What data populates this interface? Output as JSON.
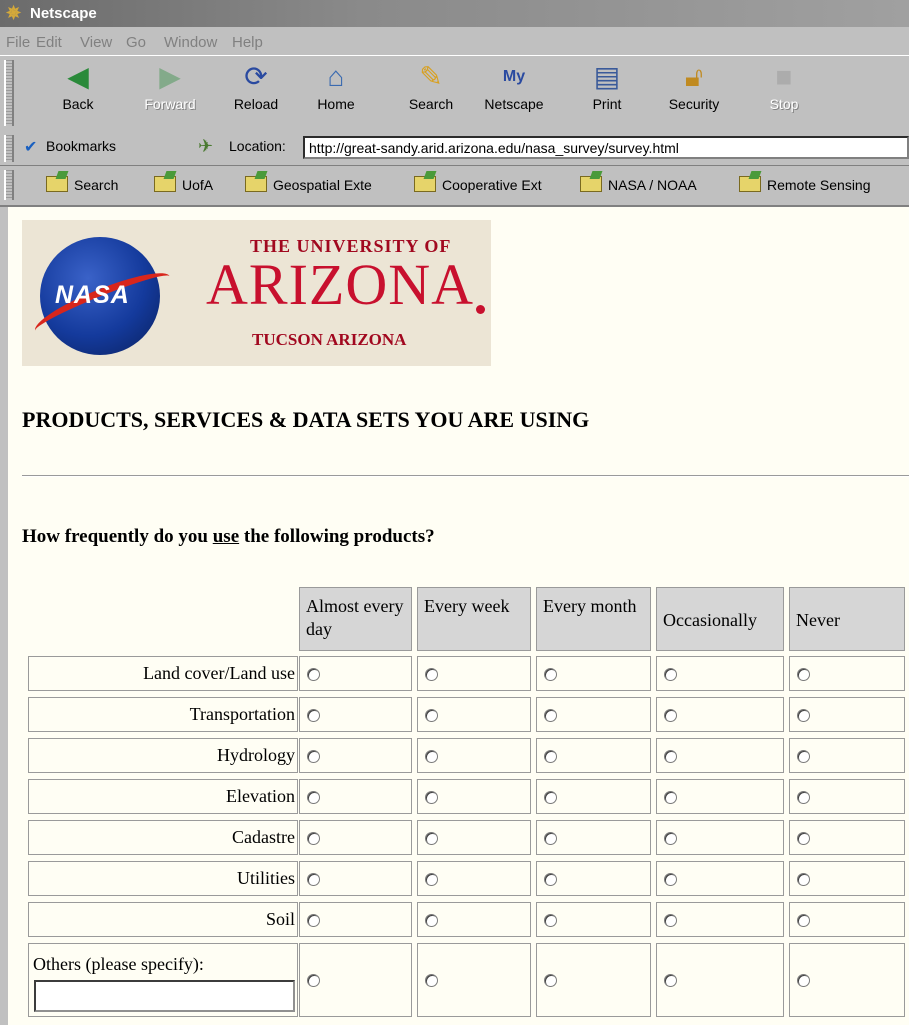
{
  "window": {
    "title": "Netscape"
  },
  "menu": [
    "File",
    "Edit",
    "View",
    "Go",
    "Window",
    "Help"
  ],
  "nav_buttons": [
    {
      "label": "Back",
      "enabled": true
    },
    {
      "label": "Forward",
      "enabled": false
    },
    {
      "label": "Reload",
      "enabled": true
    },
    {
      "label": "Home",
      "enabled": true
    },
    {
      "label": "Search",
      "enabled": true
    },
    {
      "label": "Netscape",
      "enabled": true
    },
    {
      "label": "Print",
      "enabled": true
    },
    {
      "label": "Security",
      "enabled": true
    },
    {
      "label": "Stop",
      "enabled": false
    }
  ],
  "location_bar": {
    "bookmarks_label": "Bookmarks",
    "location_label": "Location:",
    "url": "http://great-sandy.arid.arizona.edu/nasa_survey/survey.html"
  },
  "personal_toolbar": [
    "Search",
    "UofA",
    "Geospatial Exte",
    "Cooperative Ext",
    "NASA / NOAA",
    "Remote Sensing"
  ],
  "banner": {
    "nasa_text": "NASA",
    "university_top": "THE UNIVERSITY OF",
    "university_name": "ARIZONA",
    "university_bottom": "TUCSON ARIZONA"
  },
  "page": {
    "section_title": "PRODUCTS, SERVICES & DATA SETS YOU ARE USING",
    "question_prefix": "How frequently do you ",
    "question_emph": "use",
    "question_suffix": " the following products?"
  },
  "table": {
    "columns": [
      "Almost every day",
      "Every week",
      "Every month",
      "Occasionally",
      "Never"
    ],
    "rows": [
      "Land cover/Land use",
      "Transportation",
      "Hydrology",
      "Elevation",
      "Cadastre",
      "Utilities",
      "Soil"
    ],
    "others_label": "Others (please specify):",
    "others_value": ""
  }
}
